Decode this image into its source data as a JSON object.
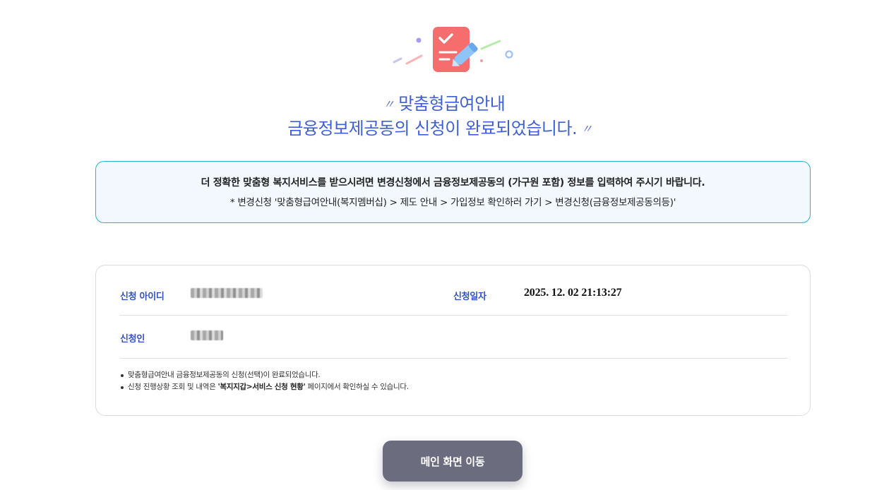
{
  "headline": {
    "quote_open": "〃",
    "line1": "맞춤형급여안내",
    "line2": "금융정보제공동의 신청이 완료되었습니다.",
    "quote_close": "〃"
  },
  "notice": {
    "line1": "더 정확한 맞춤형 복지서비스를 받으시려면 변경신청에서 금융정보제공동의 (가구원 포함) 정보를 입력하여 주시기 바랍니다.",
    "line2": "* 변경신청 '맞춤형급여안내(복지멤버십) > 제도 안내 > 가입정보 확인하러 가기 > 변경신청(금융정보제공동의등)'"
  },
  "details": {
    "id_label": "신청 아이디",
    "date_label": "신청일자",
    "date_value": "2025. 12. 02 21:13:27",
    "applicant_label": "신청인"
  },
  "notes": {
    "note1": "맞춤형급여안내 금융정보제공동의 신청(선택)이 완료되었습니다.",
    "note2_prefix": "신청 진행상황 조회 및 내역은 ",
    "note2_bold": "'복지지갑>서비스 신청 현황'",
    "note2_suffix": " 페이지에서 확인하실 수 있습니다."
  },
  "buttons": {
    "main_label": "메인 화면 이동"
  },
  "colors": {
    "accent_blue": "#3f5fd6",
    "notice_border": "#25b6cf",
    "notice_bg": "#f3f8fe",
    "button_bg": "#6b6d7f",
    "icon_red": "#f36b6b"
  },
  "icons": {
    "hero": "checklist-pencil-icon"
  }
}
